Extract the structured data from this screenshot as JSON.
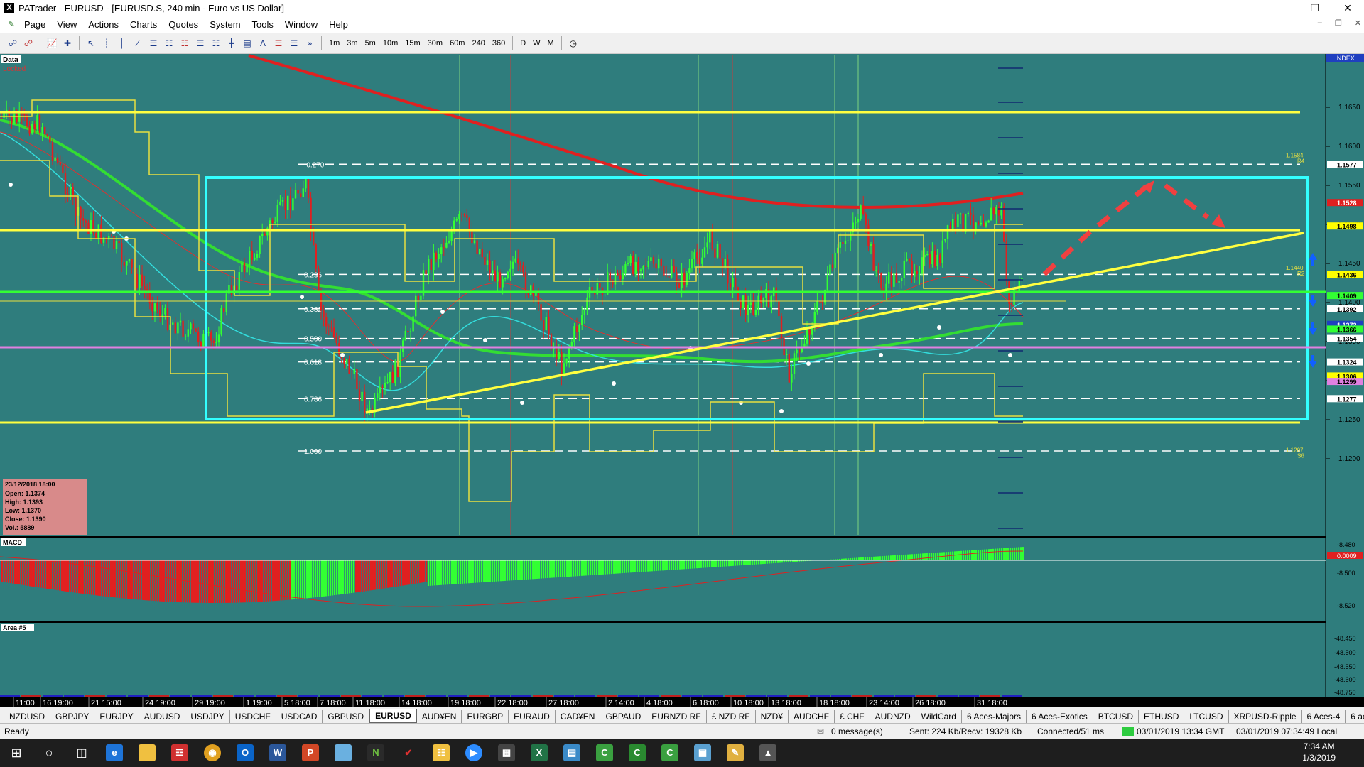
{
  "window": {
    "title": "PATrader - EURUSD - [EURUSD.S, 240 min - Euro vs US Dollar]",
    "app_letter": "X"
  },
  "menu": [
    "Page",
    "View",
    "Actions",
    "Charts",
    "Quotes",
    "System",
    "Tools",
    "Window",
    "Help"
  ],
  "timeframes": [
    "1m",
    "3m",
    "5m",
    "10m",
    "15m",
    "30m",
    "60m",
    "240",
    "360",
    "D",
    "W",
    "M"
  ],
  "chart": {
    "data_label": "Data",
    "locked_label": "Locked",
    "index_label": "INDEX",
    "macd_label": "MACD",
    "area_label": "Area #5",
    "price_ticks": [
      "1.1650",
      "1.1600",
      "1.1550",
      "1.1500",
      "1.1450",
      "1.1400",
      "1.1350",
      "1.1300",
      "1.1250",
      "1.1200"
    ],
    "price_tags": [
      {
        "value": "1.1577",
        "bg": "#ffffff",
        "fg": "#000000"
      },
      {
        "value": "1.1528",
        "bg": "#e02020",
        "fg": "#ffffff"
      },
      {
        "value": "1.1498",
        "bg": "#ffff00",
        "fg": "#000000"
      },
      {
        "value": "1.1436",
        "bg": "#ffff00",
        "fg": "#000000"
      },
      {
        "value": "1.1409",
        "bg": "#33ff33",
        "fg": "#000000"
      },
      {
        "value": "1.1392",
        "bg": "#ffffff",
        "fg": "#000000"
      },
      {
        "value": "1.1372",
        "bg": "#1f3fc0",
        "fg": "#ffffff"
      },
      {
        "value": "1.1366",
        "bg": "#33ff33",
        "fg": "#000000"
      },
      {
        "value": "1.1354",
        "bg": "#ffffff",
        "fg": "#000000"
      },
      {
        "value": "1.1324",
        "bg": "#ffffff",
        "fg": "#000000"
      },
      {
        "value": "1.1306",
        "bg": "#ffff00",
        "fg": "#000000"
      },
      {
        "value": "1.1299",
        "bg": "#e080e0",
        "fg": "#000000"
      },
      {
        "value": "1.1277",
        "bg": "#ffffff",
        "fg": "#000000"
      }
    ],
    "fib_levels": [
      {
        "label": "-0.270",
        "price": 1.1577
      },
      {
        "label": "0.236",
        "price": 1.1436
      },
      {
        "label": "0.382",
        "price": 1.1392
      },
      {
        "label": "0.500",
        "price": 1.1354
      },
      {
        "label": "0.618",
        "price": 1.1324
      },
      {
        "label": "0.786",
        "price": 1.1277
      },
      {
        "label": "1.000",
        "price": 1.121
      }
    ],
    "right_labels": [
      {
        "text": "1.1584",
        "sub": "R4",
        "price": 1.1584
      },
      {
        "text": "1.1440",
        "sub": "R2",
        "price": 1.144
      },
      {
        "text": "1.1207",
        "sub": "S6",
        "price": 1.1207
      }
    ],
    "macd_ticks": [
      "-8.480",
      "0.0009",
      "-8.500",
      "-8.520"
    ],
    "area_ticks": [
      "-48.450",
      "-48.500",
      "-48.550",
      "-48.600",
      "-48.750"
    ],
    "date_labels": [
      "11:00",
      "16 19:00",
      "21 15:00",
      "24 19:00",
      "29 19:00",
      "1 19:00",
      "5 18:00",
      "7 18:00",
      "11 18:00",
      "14 18:00",
      "19 18:00",
      "22 18:00",
      "27 18:00",
      "2 14:00",
      "4 18:00",
      "6 18:00",
      "10 18:00",
      "13 18:00",
      "18 18:00",
      "23 14:00",
      "26 18:00",
      "31 18:00"
    ],
    "ohlc": {
      "date": "23/12/2018 18:00",
      "open": "Open: 1.1374",
      "high": "High: 1.1393",
      "low": "Low: 1.1370",
      "close": "Close: 1.1390",
      "vol": "Vol.: 5889"
    }
  },
  "symbols": [
    "NZDUSD",
    "GBPJPY",
    "EURJPY",
    "AUDUSD",
    "USDJPY",
    "USDCHF",
    "USDCAD",
    "GBPUSD",
    "EURUSD",
    "AUD¥EN",
    "EURGBP",
    "EURAUD",
    "CAD¥EN",
    "GBPAUD",
    "EURNZD RF",
    "£ NZD RF",
    "NZD¥",
    "AUDCHF",
    "£ CHF",
    "AUDNZD",
    "WildCard",
    "6 Aces-Majors",
    "6 Aces-Exotics",
    "BTCUSD",
    "ETHUSD",
    "LTCUSD",
    "XRPUSD-Ripple",
    "6 Aces-4",
    "6 aces 2"
  ],
  "active_symbol": "EURUSD",
  "status": {
    "ready": "Ready",
    "messages": "0 message(s)",
    "traffic": "Sent: 224 Kb/Recv: 19328 Kb",
    "connection": "Connected/51 ms",
    "gmt": "03/01/2019 13:34 GMT",
    "local": "03/01/2019 07:34:49 Local"
  },
  "taskbar": {
    "time": "7:34 AM",
    "date": "1/3/2019"
  }
}
